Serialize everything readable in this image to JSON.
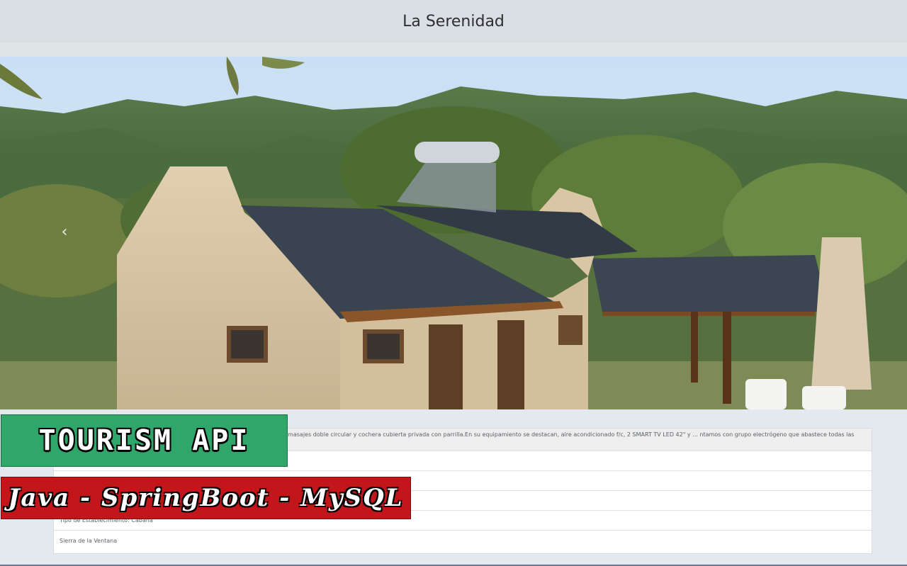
{
  "header": {
    "title": "La Serenidad"
  },
  "carousel": {
    "prev_icon": "chevron-left-icon",
    "prev_glyph": "‹"
  },
  "details": {
    "description": "ción suite con cama king size, dos sofá cama en el estar, ante baño, baño, hidromasajes doble circular y cochera cubierta privada con parrilla.En su equipamiento se destacan, aire acondicionado f/c, 2 SMART TV LED 42\" y ... ntamos con grupo electrógeno que abastece todas las necesidades eléctricas del complejo.",
    "row2": "",
    "row3": "",
    "row4": "",
    "category": "Tipo de Establecimiento: Cabaña",
    "location": "Sierra de la Ventana"
  },
  "overlay": {
    "title": "TOURISM API",
    "stack": "Java - SpringBoot - MySQL"
  },
  "colors": {
    "green_banner": "#2fa76a",
    "red_banner": "#c2161b",
    "header_bg": "#d9dfe2"
  }
}
